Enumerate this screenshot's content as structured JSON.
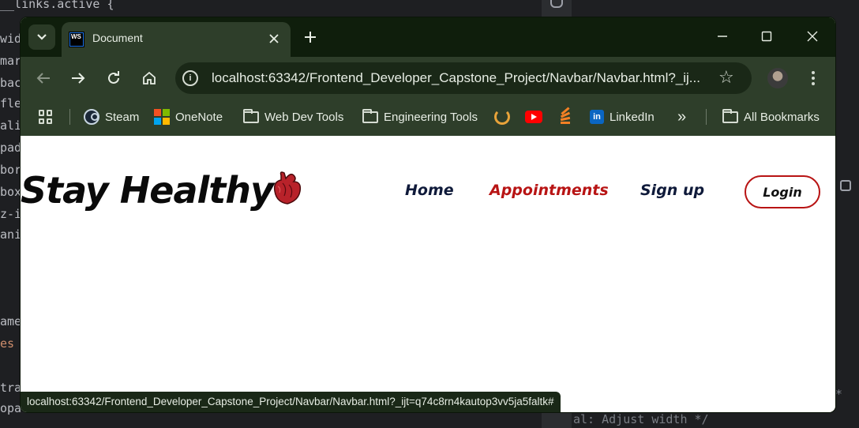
{
  "ide": {
    "code_lines": [
      "__links.active {",
      "wid",
      "mar",
      "bac",
      "fle",
      "ali",
      "pad",
      "bor",
      "box",
      "z-i",
      "ani",
      "ame",
      "es",
      "tra",
      "opa"
    ],
    "right_text": "al: Adjust width */",
    "right_text2": "g *"
  },
  "browser": {
    "tab": {
      "title": "Document",
      "favicon_text": "WS"
    },
    "toolbar": {
      "url": "localhost:63342/Frontend_Developer_Capstone_Project/Navbar/Navbar.html?_ij...",
      "icons": [
        "back-icon",
        "forward-icon",
        "reload-icon",
        "home-icon",
        "site-info-icon",
        "star-icon",
        "profile-avatar",
        "menu-icon"
      ]
    },
    "bookmarks": [
      {
        "label": "Steam",
        "icon": "steam-icon"
      },
      {
        "label": "OneNote",
        "icon": "microsoft-icon"
      },
      {
        "label": "Web Dev Tools",
        "icon": "folder-icon"
      },
      {
        "label": "Engineering Tools",
        "icon": "folder-icon"
      },
      {
        "label": "LinkedIn",
        "icon": "linkedin-icon"
      }
    ],
    "overflow_label": "»",
    "all_bookmarks": "All Bookmarks",
    "status_url": "localhost:63342/Frontend_Developer_Capstone_Project/Navbar/Navbar.html?_ijt=q74c8rn4kautop3vv5ja5faltk#"
  },
  "page": {
    "logo": "Stay Healthy",
    "nav": [
      {
        "label": "Home",
        "color": "#0f1a3a"
      },
      {
        "label": "Appointments",
        "color": "#b81414"
      },
      {
        "label": "Sign up",
        "color": "#0f1a3a"
      }
    ],
    "login": "Login"
  },
  "colors": {
    "window_frame": "#0f1e0c",
    "toolbar": "#2e3e2a",
    "accent_red": "#b81414"
  }
}
